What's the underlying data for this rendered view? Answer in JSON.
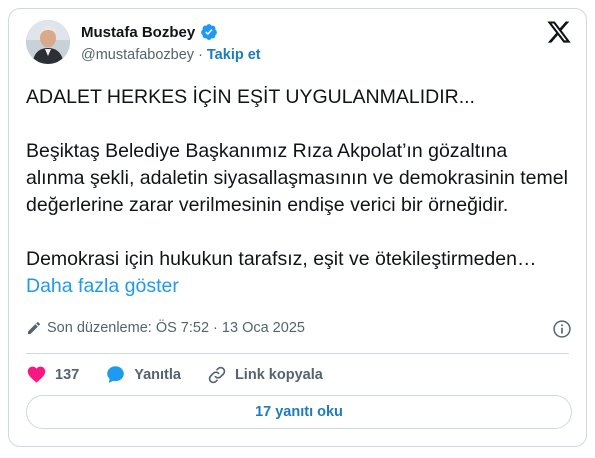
{
  "author": {
    "name": "Mustafa Bozbey",
    "handle": "@mustafabozbey",
    "separator": "·",
    "follow_label": "Takip et"
  },
  "tweet": {
    "text": "ADALET HERKES İÇİN EŞİT UYGULANMALIDIR...\n\nBeşiktaş Belediye Başkanımız Rıza Akpolat’ın gözaltına alınma şekli, adaletin siyasallaşmasının ve demokrasinin temel değerlerine zarar verilmesinin endişe verici bir örneğidir.\n\nDemokrasi için hukukun tarafsız, eşit ve ötekileştirmeden… ",
    "show_more": "Daha fazla göster"
  },
  "meta": {
    "edited": "Son düzenleme: ÖS 7:52 · 13 Oca 2025"
  },
  "actions": {
    "like_count": "137",
    "reply_label": "Yanıtla",
    "copy_link_label": "Link kopyala"
  },
  "replies": {
    "button_label": "17 yanıtı oku"
  },
  "colors": {
    "accent": "#1d9bf0",
    "like": "#f91880",
    "verified": "#1d9bf0"
  },
  "icons": {
    "verified": "verified-badge-icon",
    "x_logo": "x-logo-icon",
    "edit": "pencil-icon",
    "info": "info-icon",
    "like": "heart-icon",
    "reply": "speech-bubble-icon",
    "link": "link-icon"
  }
}
